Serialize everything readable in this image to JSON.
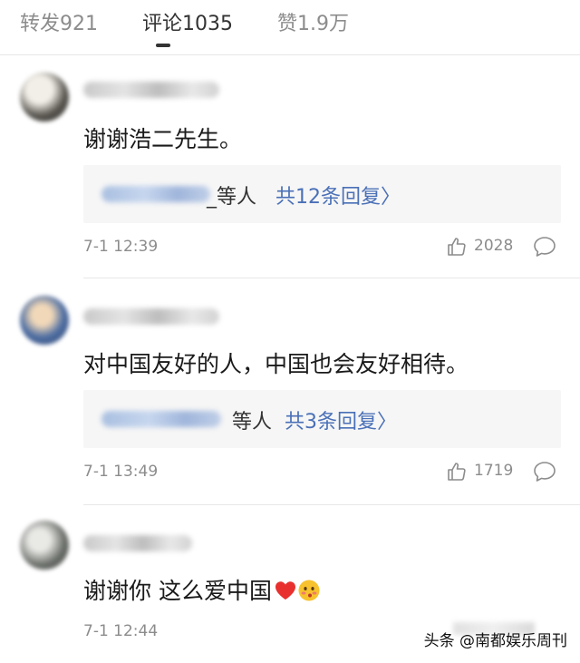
{
  "tabs": {
    "repost": "转发921",
    "comments": "评论1035",
    "likes": "赞1.9万"
  },
  "comments": [
    {
      "text": "谢谢浩二先生。",
      "reply_users_suffix": "_等人",
      "reply_count": "共12条回复",
      "time": "7-1 12:39",
      "likes": "2028"
    },
    {
      "text": "对中国友好的人，中国也会友好相待。",
      "reply_users_suffix": "等人",
      "reply_count": "共3条回复",
      "time": "7-1 13:49",
      "likes": "1719"
    },
    {
      "text": "谢谢你 这么爱中国",
      "time": "7-1 12:44"
    }
  ],
  "reply_chevron": "〉",
  "icons": {
    "like": "thumbs-up-icon",
    "comment": "chat-bubble-icon",
    "heart": "heart-icon",
    "emoji": "blushing-face-icon"
  },
  "colors": {
    "link_blue": "#4a70b7",
    "meta_gray": "#8c8c8c",
    "reply_bg": "#f6f6f6",
    "heart_red": "#e8312f"
  },
  "watermark": "头条 @南都娱乐周刊"
}
